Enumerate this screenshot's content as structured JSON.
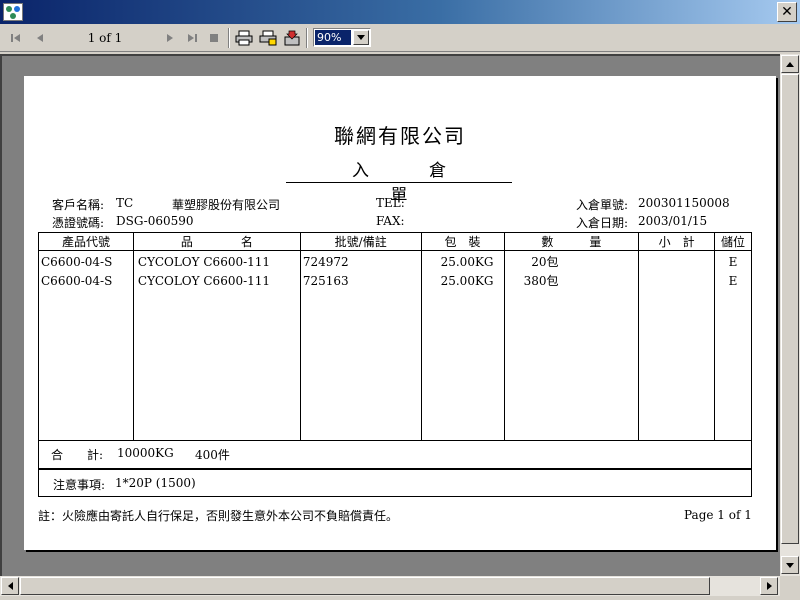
{
  "toolbar": {
    "page_label": "1 of 1",
    "zoom": "90%"
  },
  "report": {
    "company": "聯網有限公司",
    "title_chars": [
      "入",
      "倉",
      "單"
    ],
    "header": {
      "customer_label": "客戶名稱:",
      "customer_code": "TC",
      "customer_name": "華塑膠股份有限公司",
      "voucher_label": "憑證號碼:",
      "voucher_no": "DSG-060590",
      "tel_label": "TEL:",
      "fax_label": "FAX:",
      "order_label": "入倉單號:",
      "order_no": "200301150008",
      "date_label": "入倉日期:",
      "date": "2003/01/15"
    },
    "columns": [
      "產品代號",
      "品　　　　名",
      "批號/備註",
      "包　裝",
      "數　　　量",
      "小　計",
      "儲位"
    ],
    "rows": [
      {
        "code": "C6600-04-S",
        "name": "CYCOLOY C6600-111",
        "lot": "724972",
        "pack": "25.00KG",
        "qty": "20包",
        "subtotal": "",
        "loc": "E"
      },
      {
        "code": "C6600-04-S",
        "name": "CYCOLOY C6600-111",
        "lot": "725163",
        "pack": "25.00KG",
        "qty": "380包",
        "subtotal": "",
        "loc": "E"
      }
    ],
    "total": {
      "label": "合　　計:",
      "weight": "10000KG",
      "pieces": "400件"
    },
    "note": {
      "label": "注意事項:",
      "value": "1*20P (1500)"
    },
    "footer_note": "註：火險應由寄託人自行保足，否則發生意外本公司不負賠償責任。",
    "page_no": "Page 1 of 1"
  }
}
